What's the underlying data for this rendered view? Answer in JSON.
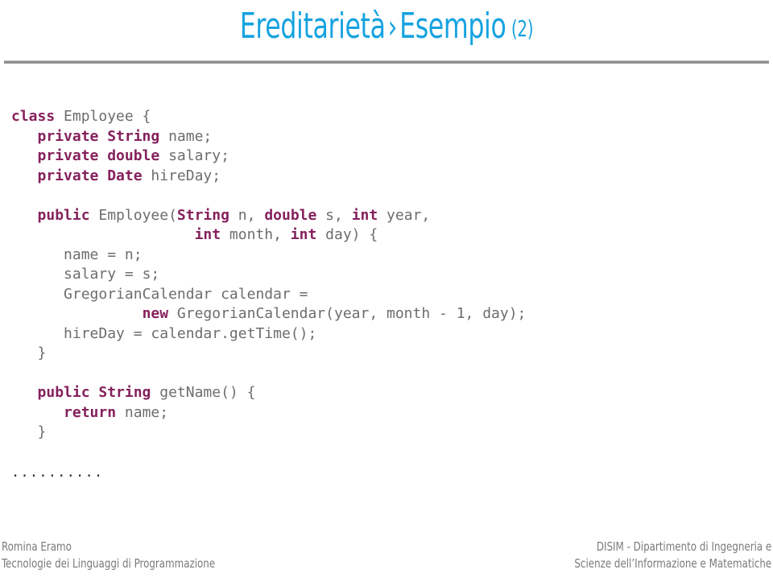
{
  "slide": {
    "title": {
      "main": "Ereditarietà",
      "separator": "›",
      "rest": "Esempio",
      "number": "(2)",
      "color": "#16a3e0"
    },
    "rule_color": "#8f8f8f"
  },
  "code": {
    "language": "java",
    "keyword_color": "#85215c",
    "text_color": "#6d6d6d",
    "lines": [
      {
        "indent": 0,
        "tokens": [
          {
            "t": "class",
            "kw": true
          },
          {
            "t": " Employee {",
            "kw": false
          }
        ]
      },
      {
        "indent": 3,
        "tokens": [
          {
            "t": "private String",
            "kw": true
          },
          {
            "t": " name;",
            "kw": false
          }
        ]
      },
      {
        "indent": 3,
        "tokens": [
          {
            "t": "private double",
            "kw": true
          },
          {
            "t": " salary;",
            "kw": false
          }
        ]
      },
      {
        "indent": 3,
        "tokens": [
          {
            "t": "private Date",
            "kw": true
          },
          {
            "t": " hireDay;",
            "kw": false
          }
        ]
      },
      {
        "indent": 0,
        "tokens": []
      },
      {
        "indent": 3,
        "tokens": [
          {
            "t": "public",
            "kw": true
          },
          {
            "t": " Employee(",
            "kw": false
          },
          {
            "t": "String",
            "kw": true
          },
          {
            "t": " n, ",
            "kw": false
          },
          {
            "t": "double",
            "kw": true
          },
          {
            "t": " s, ",
            "kw": false
          },
          {
            "t": "int",
            "kw": true
          },
          {
            "t": " year,",
            "kw": false
          }
        ]
      },
      {
        "indent": 21,
        "tokens": [
          {
            "t": "int",
            "kw": true
          },
          {
            "t": " month, ",
            "kw": false
          },
          {
            "t": "int",
            "kw": true
          },
          {
            "t": " day) {",
            "kw": false
          }
        ]
      },
      {
        "indent": 6,
        "tokens": [
          {
            "t": "name = n;",
            "kw": false
          }
        ]
      },
      {
        "indent": 6,
        "tokens": [
          {
            "t": "salary = s;",
            "kw": false
          }
        ]
      },
      {
        "indent": 6,
        "tokens": [
          {
            "t": "GregorianCalendar calendar =",
            "kw": false
          }
        ]
      },
      {
        "indent": 15,
        "tokens": [
          {
            "t": "new",
            "kw": true
          },
          {
            "t": " GregorianCalendar(year, month - 1, day);",
            "kw": false
          }
        ]
      },
      {
        "indent": 6,
        "tokens": [
          {
            "t": "hireDay = calendar.getTime();",
            "kw": false
          }
        ]
      },
      {
        "indent": 3,
        "tokens": [
          {
            "t": "}",
            "kw": false
          }
        ]
      },
      {
        "indent": 0,
        "tokens": []
      },
      {
        "indent": 3,
        "tokens": [
          {
            "t": "public String",
            "kw": true
          },
          {
            "t": " getName() {",
            "kw": false
          }
        ]
      },
      {
        "indent": 6,
        "tokens": [
          {
            "t": "return",
            "kw": true
          },
          {
            "t": " name;",
            "kw": false
          }
        ]
      },
      {
        "indent": 3,
        "tokens": [
          {
            "t": "}",
            "kw": false
          }
        ]
      }
    ]
  },
  "ellipsis": {
    "text": "......................."
  },
  "footer": {
    "left": {
      "line1": "Romina Eramo",
      "line2": "Tecnologie dei Linguaggi di Programmazione"
    },
    "right": {
      "line1": "DISIM - Dipartimento di Ingegneria e",
      "line2": "Scienze dell’Informazione e Matematiche"
    },
    "color": "#7a7a7a"
  }
}
